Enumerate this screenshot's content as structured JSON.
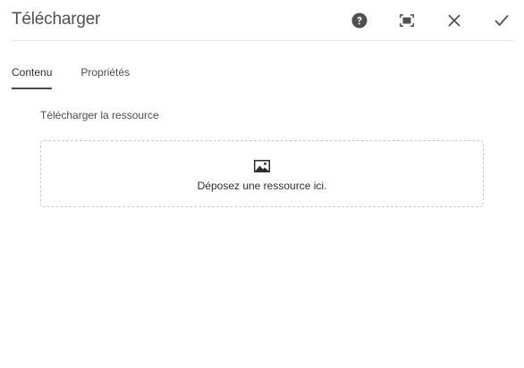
{
  "dialog": {
    "title": "Télécharger",
    "actions": [
      {
        "name": "help",
        "icon": "help-icon"
      },
      {
        "name": "fullscreen",
        "icon": "fullscreen-icon"
      },
      {
        "name": "close",
        "icon": "close-icon"
      },
      {
        "name": "done",
        "icon": "checkmark-icon"
      }
    ]
  },
  "tabs": [
    {
      "label": "Contenu",
      "active": true
    },
    {
      "label": "Propriétés",
      "active": false
    }
  ],
  "content": {
    "field_label": "Télécharger la ressource",
    "dropzone": {
      "icon": "image-icon",
      "text": "Déposez une ressource ici."
    }
  },
  "colors": {
    "text": "#323232",
    "divider": "#e4e4e4",
    "dropzone_border": "#c9c9c9",
    "icon": "#505050"
  }
}
